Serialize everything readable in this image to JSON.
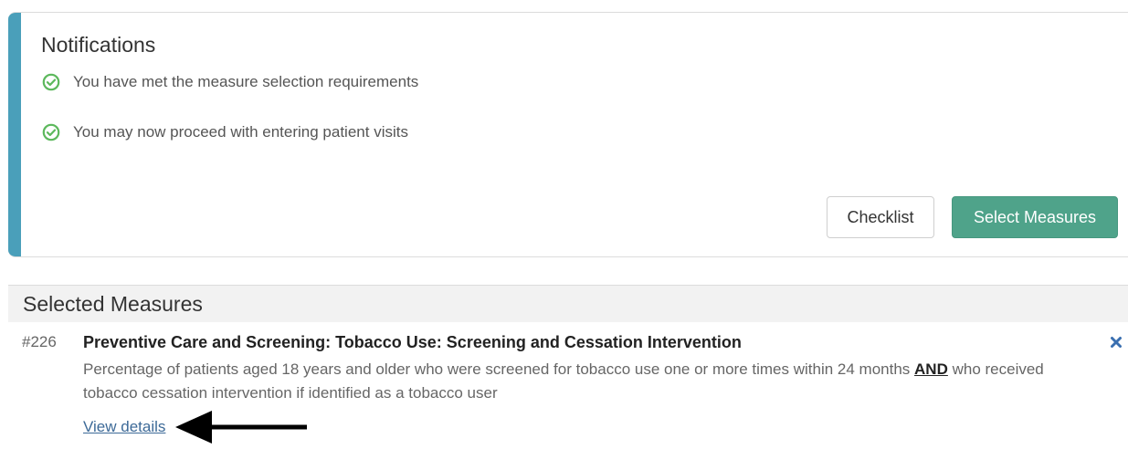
{
  "notifications": {
    "title": "Notifications",
    "items": [
      {
        "icon": "check-circle-icon",
        "text": "You have met the measure selection requirements"
      },
      {
        "icon": "check-circle-icon",
        "text": "You may now proceed with entering patient visits"
      }
    ],
    "checklist_label": "Checklist",
    "select_measures_label": "Select Measures"
  },
  "selected_measures": {
    "title": "Selected Measures",
    "measures": [
      {
        "number": "#226",
        "title": "Preventive Care and Screening: Tobacco Use: Screening and Cessation Intervention",
        "description_part1": "Percentage of patients aged 18 years and older who were screened for tobacco use one or more times within 24 months ",
        "description_emphasis": "AND",
        "description_part2": " who received tobacco cessation intervention if identified as a tobacco user",
        "view_details_label": "View details",
        "remove_icon": "close-x-icon"
      }
    ]
  },
  "colors": {
    "accent": "#4a9fba",
    "primary_button": "#4fa38a",
    "success_check": "#5cb85c",
    "link": "#3d6a98",
    "remove_x": "#3a6fb0"
  }
}
